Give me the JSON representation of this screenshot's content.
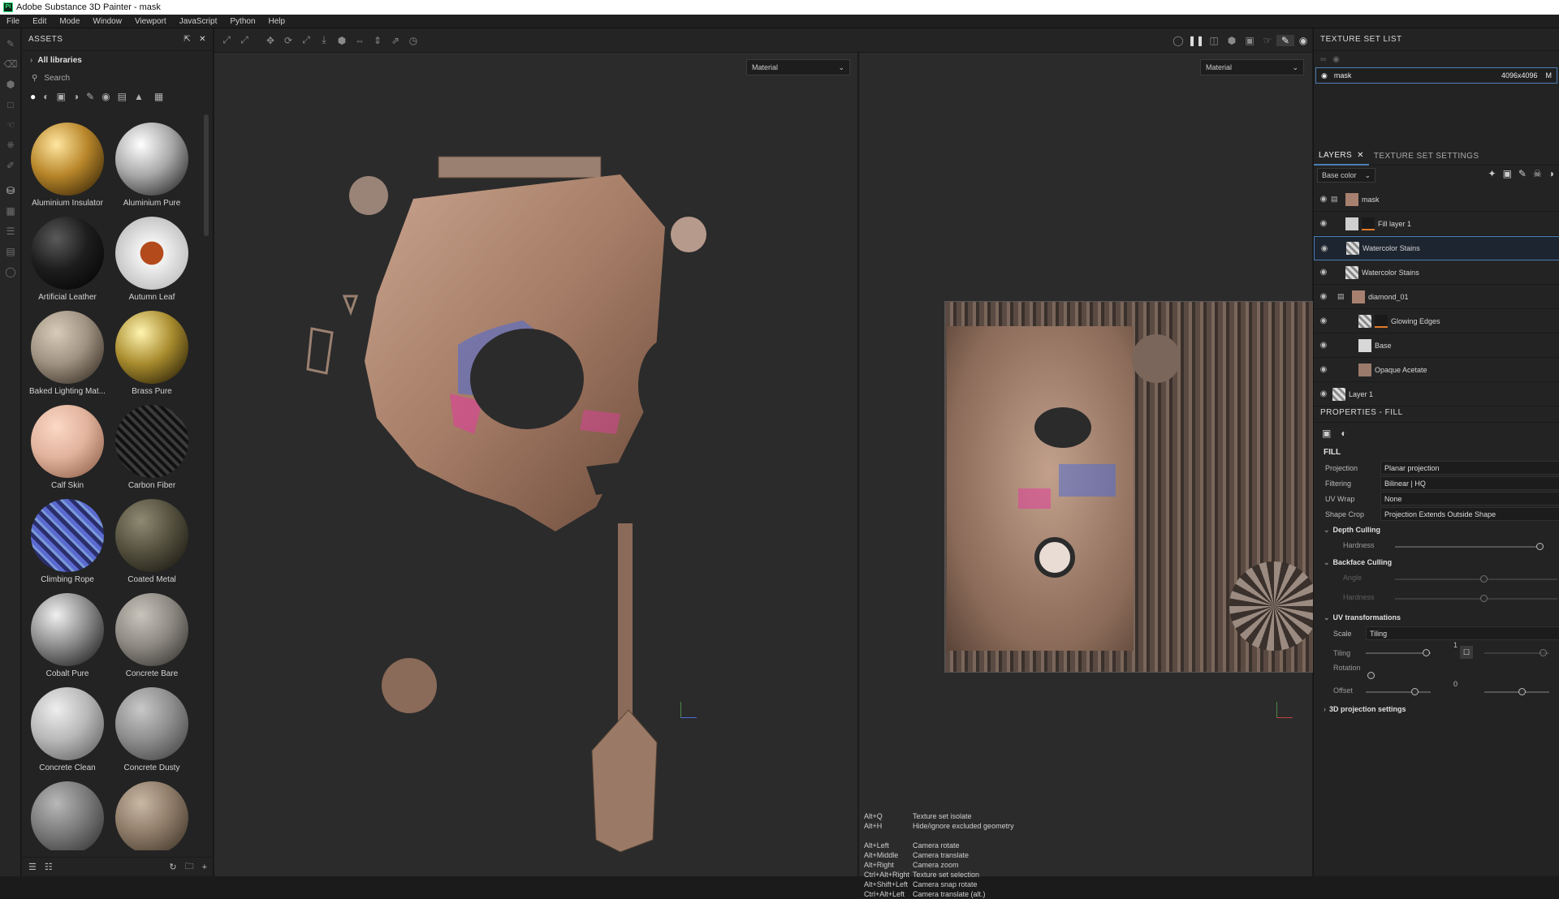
{
  "window": {
    "title": "Adobe Substance 3D Painter - mask",
    "logo": "Pt"
  },
  "menu": [
    "File",
    "Edit",
    "Mode",
    "Window",
    "Viewport",
    "JavaScript",
    "Python",
    "Help"
  ],
  "assets": {
    "header": "ASSETS",
    "library": "All libraries",
    "search_placeholder": "Search",
    "items": [
      {
        "label": "Aluminium Insulator",
        "color": "#b8862a"
      },
      {
        "label": "Aluminium Pure",
        "color": "#c9c9c9"
      },
      {
        "label": "Artificial Leather",
        "color": "#1d1d1d"
      },
      {
        "label": "Autumn Leaf",
        "color": "#e8e8e8"
      },
      {
        "label": "Baked Lighting Mat...",
        "color": "#9f9282"
      },
      {
        "label": "Brass Pure",
        "color": "#a98c2e"
      },
      {
        "label": "Calf Skin",
        "color": "#e1b39c"
      },
      {
        "label": "Carbon Fiber",
        "color": "#2a2a2a"
      },
      {
        "label": "Climbing Rope",
        "color": "#3c3f8f"
      },
      {
        "label": "Coated Metal",
        "color": "#55513f"
      },
      {
        "label": "Cobalt Pure",
        "color": "#8d8d8d"
      },
      {
        "label": "Concrete Bare",
        "color": "#8e8a83"
      },
      {
        "label": "Concrete Clean",
        "color": "#b8b8b8"
      },
      {
        "label": "Concrete Dusty",
        "color": "#8e8e8e"
      },
      {
        "label": "",
        "color": "#7a7a7a"
      },
      {
        "label": "",
        "color": "#8d7b68"
      }
    ]
  },
  "viewport": {
    "left_mode": "Material",
    "right_mode": "Material",
    "hints": [
      {
        "key": "Alt+Q",
        "action": "Texture set isolate"
      },
      {
        "key": "Alt+H",
        "action": "Hide/ignore excluded geometry"
      },
      {
        "key": "",
        "action": ""
      },
      {
        "key": "Alt+Left",
        "action": "Camera rotate"
      },
      {
        "key": "Alt+Middle",
        "action": "Camera translate"
      },
      {
        "key": "Alt+Right",
        "action": "Camera zoom"
      },
      {
        "key": "Ctrl+Alt+Right",
        "action": "Texture set selection"
      },
      {
        "key": "Alt+Shift+Left",
        "action": "Camera snap rotate"
      },
      {
        "key": "Ctrl+Alt+Left",
        "action": "Camera translate (alt.)"
      }
    ]
  },
  "texture_set_list": {
    "header": "TEXTURE SET LIST",
    "row_name": "mask",
    "row_size": "4096x4096",
    "row_extra": "M"
  },
  "layers": {
    "tab_layers": "LAYERS",
    "tab_settings": "TEXTURE SET SETTINGS",
    "channel": "Base color",
    "items": [
      {
        "name": "mask",
        "indent": 0,
        "folder": true
      },
      {
        "name": "Fill layer 1",
        "indent": 1,
        "folder": false
      },
      {
        "name": "Watercolor Stains",
        "indent": 1,
        "folder": false,
        "selected": true
      },
      {
        "name": "Watercolor Stains",
        "indent": 1,
        "folder": false
      },
      {
        "name": "diamond_01",
        "indent": 1,
        "folder": true
      },
      {
        "name": "Glowing Edges",
        "indent": 2,
        "folder": false
      },
      {
        "name": "Base",
        "indent": 2,
        "folder": false
      },
      {
        "name": "Opaque Acetate",
        "indent": 2,
        "folder": false
      },
      {
        "name": "Layer 1",
        "indent": 0,
        "folder": false
      }
    ]
  },
  "properties": {
    "header": "PROPERTIES - FILL",
    "section": "FILL",
    "projection_label": "Projection",
    "projection": "Planar projection",
    "filtering_label": "Filtering",
    "filtering": "Bilinear | HQ",
    "uvwrap_label": "UV Wrap",
    "uvwrap": "None",
    "shapecrop_label": "Shape Crop",
    "shapecrop": "Projection Extends Outside Shape",
    "depth_culling": "Depth Culling",
    "hardness_label": "Hardness",
    "backface_culling": "Backface Culling",
    "angle_label": "Angle",
    "hardness2_label": "Hardness",
    "uv_transformations": "UV transformations",
    "scale_label": "Scale",
    "scale": "Tiling",
    "tiling_label": "Tiling",
    "tiling_value": "1",
    "rotation_label": "Rotation",
    "offset_label": "Offset",
    "offset_value": "0",
    "projection_3d": "3D projection settings"
  }
}
